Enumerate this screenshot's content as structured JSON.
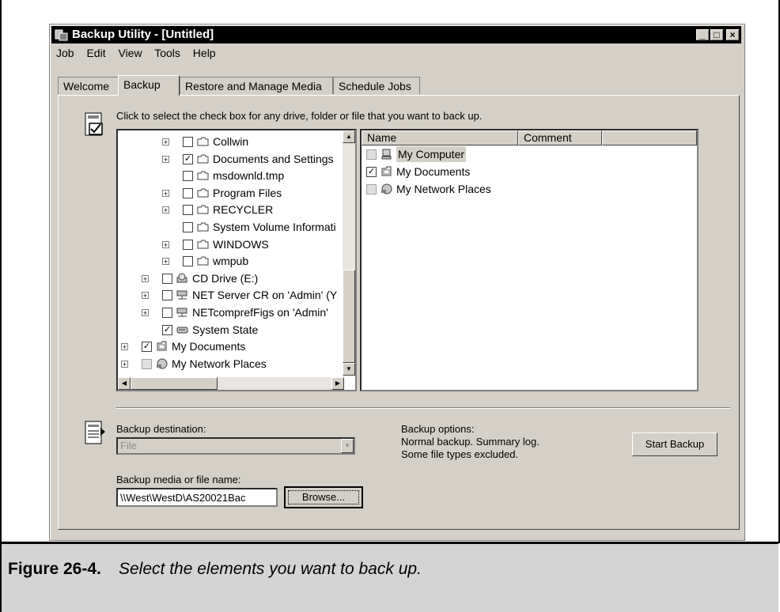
{
  "window": {
    "title": "Backup Utility - [Untitled]",
    "controls": [
      "_",
      "□",
      "×"
    ]
  },
  "menu": [
    "Job",
    "Edit",
    "View",
    "Tools",
    "Help"
  ],
  "tabs": [
    "Welcome",
    "Backup",
    "Restore and Manage Media",
    "Schedule Jobs"
  ],
  "active_tab": "Backup",
  "hint": "Click to select the check box for any drive, folder or file that you want to back up.",
  "tree": [
    {
      "label": "Collwin",
      "expander": true,
      "checked": false,
      "icon": "folder-icon",
      "indent": 3
    },
    {
      "label": "Documents and Settings",
      "expander": true,
      "checked": true,
      "icon": "folder-icon",
      "indent": 3
    },
    {
      "label": "msdownld.tmp",
      "expander": false,
      "checked": false,
      "icon": "folder-icon",
      "indent": 3
    },
    {
      "label": "Program Files",
      "expander": true,
      "checked": false,
      "icon": "folder-icon",
      "indent": 3
    },
    {
      "label": "RECYCLER",
      "expander": true,
      "checked": false,
      "icon": "folder-icon",
      "indent": 3
    },
    {
      "label": "System Volume Informati",
      "expander": false,
      "checked": false,
      "icon": "folder-icon",
      "indent": 3
    },
    {
      "label": "WINDOWS",
      "expander": true,
      "checked": false,
      "icon": "folder-icon",
      "indent": 3
    },
    {
      "label": "wmpub",
      "expander": true,
      "checked": false,
      "icon": "folder-icon",
      "indent": 3
    },
    {
      "label": "CD Drive (E:)",
      "expander": true,
      "checked": false,
      "icon": "cd-drive-icon",
      "indent": 2
    },
    {
      "label": "NET Server CR on 'Admin' (Y",
      "expander": true,
      "checked": false,
      "icon": "network-drive-icon",
      "indent": 2
    },
    {
      "label": "NETcomprefFigs on 'Admin'",
      "expander": true,
      "checked": false,
      "icon": "network-drive-icon",
      "indent": 2
    },
    {
      "label": "System State",
      "expander": false,
      "checked": true,
      "icon": "system-state-icon",
      "indent": 2
    },
    {
      "label": "My Documents",
      "expander": true,
      "checked": true,
      "icon": "my-documents-icon",
      "indent": 1
    },
    {
      "label": "My Network Places",
      "expander": true,
      "checked": false,
      "grey": true,
      "icon": "network-places-icon",
      "indent": 1
    }
  ],
  "list": {
    "columns": [
      "Name",
      "Comment"
    ],
    "items": [
      {
        "label": "My Computer",
        "checked": false,
        "grey": true,
        "icon": "my-computer-icon",
        "selected": true
      },
      {
        "label": "My Documents",
        "checked": true,
        "grey": false,
        "icon": "my-documents-icon",
        "selected": false
      },
      {
        "label": "My Network Places",
        "checked": false,
        "grey": true,
        "icon": "network-places-icon",
        "selected": false
      }
    ]
  },
  "destination": {
    "label": "Backup destination:",
    "value": "File"
  },
  "media": {
    "label": "Backup media or file name:",
    "value": "\\\\West\\WestD\\AS20021Bac",
    "browse": "Browse..."
  },
  "options": {
    "label": "Backup options:",
    "line1": "Normal backup.  Summary log.",
    "line2": "Some file types excluded."
  },
  "start_button": "Start Backup",
  "caption": {
    "label": "Figure 26-4.",
    "text": "Select the elements you want to back up."
  }
}
